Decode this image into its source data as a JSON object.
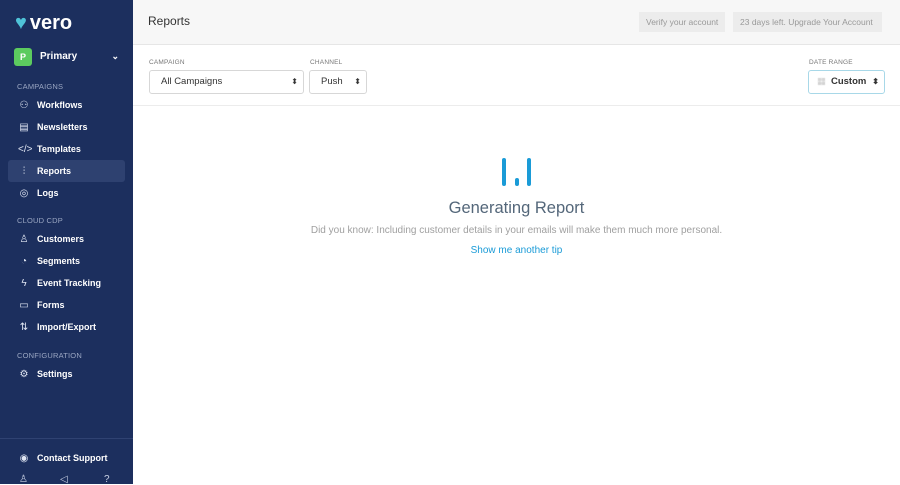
{
  "brand": "vero",
  "workspace": {
    "initial": "P",
    "name": "Primary"
  },
  "sidebar": {
    "campaigns_label": "CAMPAIGNS",
    "campaigns": [
      {
        "label": "Workflows",
        "icon": "workflow-icon"
      },
      {
        "label": "Newsletters",
        "icon": "newsletter-icon"
      },
      {
        "label": "Templates",
        "icon": "code-icon"
      },
      {
        "label": "Reports",
        "icon": "chart-icon",
        "active": true
      },
      {
        "label": "Logs",
        "icon": "logs-icon"
      }
    ],
    "cdp_label": "CLOUD CDP",
    "cdp": [
      {
        "label": "Customers",
        "icon": "user-icon"
      },
      {
        "label": "Segments",
        "icon": "pie-icon"
      },
      {
        "label": "Event Tracking",
        "icon": "bolt-icon"
      },
      {
        "label": "Forms",
        "icon": "form-icon"
      },
      {
        "label": "Import/Export",
        "icon": "import-export-icon"
      }
    ],
    "config_label": "CONFIGURATION",
    "config": [
      {
        "label": "Settings",
        "icon": "gear-icon"
      }
    ],
    "support": "Contact Support"
  },
  "header": {
    "title": "Reports",
    "verify": "Verify your account",
    "upgrade": "23 days left. Upgrade Your Account"
  },
  "filters": {
    "campaign_label": "CAMPAIGN",
    "campaign": "All Campaigns",
    "channel_label": "CHANNEL",
    "channel": "Push",
    "date_label": "DATE RANGE",
    "date": "Custom"
  },
  "status": {
    "title": "Generating Report",
    "tip": "Did you know: Including customer details in your emails will make them much more personal.",
    "another": "Show me another tip"
  },
  "colors": {
    "sidebar": "#1c2f5e",
    "accent": "#1a9bd7"
  }
}
